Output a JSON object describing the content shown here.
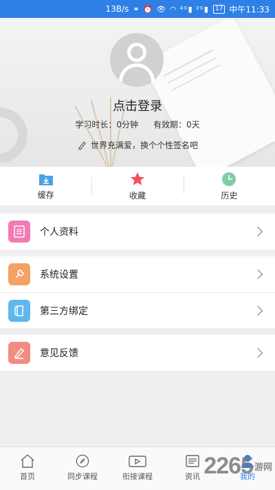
{
  "status_bar": {
    "speed": "13B/s",
    "icons": "⚭ ⏰ 👁 ◠ ⁴ᴳ▮ ²ᴳ▮",
    "battery": "17",
    "time": "中午11:33"
  },
  "profile": {
    "login_text": "点击登录",
    "study_time": "学习时长：0分钟",
    "valid_period": "有效期：0天",
    "signature": "世界充满爱，换个个性签名吧"
  },
  "quick_actions": [
    {
      "label": "缓存",
      "icon": "download-folder-icon",
      "color": "#4aa3df"
    },
    {
      "label": "收藏",
      "icon": "star-icon",
      "color": "#f0525e"
    },
    {
      "label": "历史",
      "icon": "clock-icon",
      "color": "#7ccfa5"
    }
  ],
  "menu": [
    {
      "label": "个人资料",
      "icon": "profile-document-icon",
      "color": "#f27bb5"
    },
    {
      "label": "系统设置",
      "icon": "wrench-icon",
      "color": "#f5a066"
    },
    {
      "label": "第三方绑定",
      "icon": "exit-door-icon",
      "color": "#5fb7ee"
    },
    {
      "label": "意见反馈",
      "icon": "pencil-icon",
      "color": "#f08c80"
    }
  ],
  "tabs": [
    {
      "label": "首页",
      "icon": "home-icon"
    },
    {
      "label": "同步课程",
      "icon": "compass-icon"
    },
    {
      "label": "衔接课程",
      "icon": "video-icon"
    },
    {
      "label": "资讯",
      "icon": "news-icon"
    },
    {
      "label": "我的",
      "icon": "user-icon",
      "active": true
    }
  ],
  "watermark": {
    "number": "2265",
    "text": "游网"
  },
  "colors": {
    "accent": "#2f80e6"
  }
}
